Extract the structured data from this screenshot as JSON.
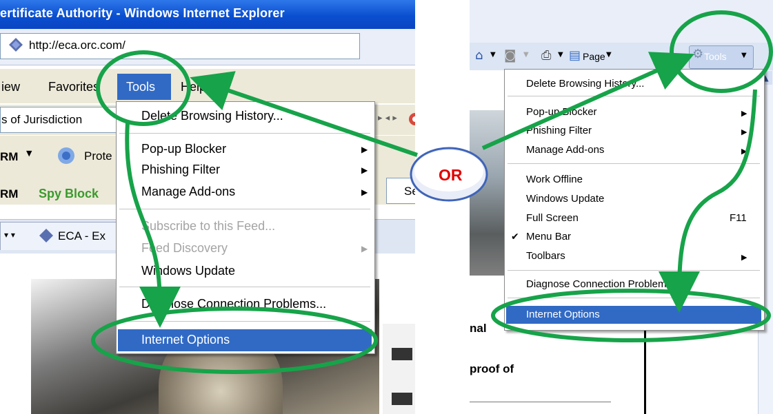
{
  "left": {
    "window_title": "ertificate Authority - Windows Internet Explorer",
    "address": "http://eca.orc.com/",
    "menubar": {
      "view": "iew",
      "favorites": "Favorites",
      "tools": "Tools",
      "help": "Help"
    },
    "jurisdiction": "s of Jurisdiction",
    "toolbar": {
      "brand1": "RM",
      "protect": "Prote",
      "brand2": "RM",
      "spy": "Spy Block",
      "search_hint": "Se"
    },
    "tab_label": "ECA - Ex",
    "tools_menu": [
      {
        "label": "Delete Browsing History...",
        "disabled": false,
        "submenu": false
      },
      {
        "label": "Pop-up Blocker",
        "disabled": false,
        "submenu": true
      },
      {
        "label": "Phishing Filter",
        "disabled": false,
        "submenu": true
      },
      {
        "label": "Manage Add-ons",
        "disabled": false,
        "submenu": true
      },
      {
        "label": "Subscribe to this Feed...",
        "disabled": true,
        "submenu": false
      },
      {
        "label": "Feed Discovery",
        "disabled": true,
        "submenu": true
      },
      {
        "label": "Windows Update",
        "disabled": false,
        "submenu": false
      },
      {
        "label": "Diagnose Connection Problems...",
        "disabled": false,
        "submenu": false
      },
      {
        "label": "Internet Options",
        "highlighted": true,
        "submenu": false
      }
    ]
  },
  "right": {
    "toolbar": {
      "page": "Page",
      "tools": "Tools"
    },
    "tools_menu": [
      {
        "label": "Delete Browsing History..."
      },
      {
        "label": "Pop-up Blocker",
        "submenu": true
      },
      {
        "label": "Phishing Filter",
        "submenu": true
      },
      {
        "label": "Manage Add-ons",
        "submenu": true
      },
      {
        "label": "Work Offline"
      },
      {
        "label": "Windows Update"
      },
      {
        "label": "Full Screen",
        "shortcut": "F11"
      },
      {
        "label": "Menu Bar",
        "checked": true
      },
      {
        "label": "Toolbars",
        "submenu": true
      },
      {
        "label": "Diagnose Connection Problems..."
      },
      {
        "label": "Internet Options",
        "highlighted": true
      }
    ],
    "page_text": {
      "line1": "nal",
      "line2": "proof of"
    }
  },
  "annotation": {
    "or_label": "OR",
    "colors": {
      "circle": "#17a349",
      "or_text": "#e10000"
    }
  }
}
